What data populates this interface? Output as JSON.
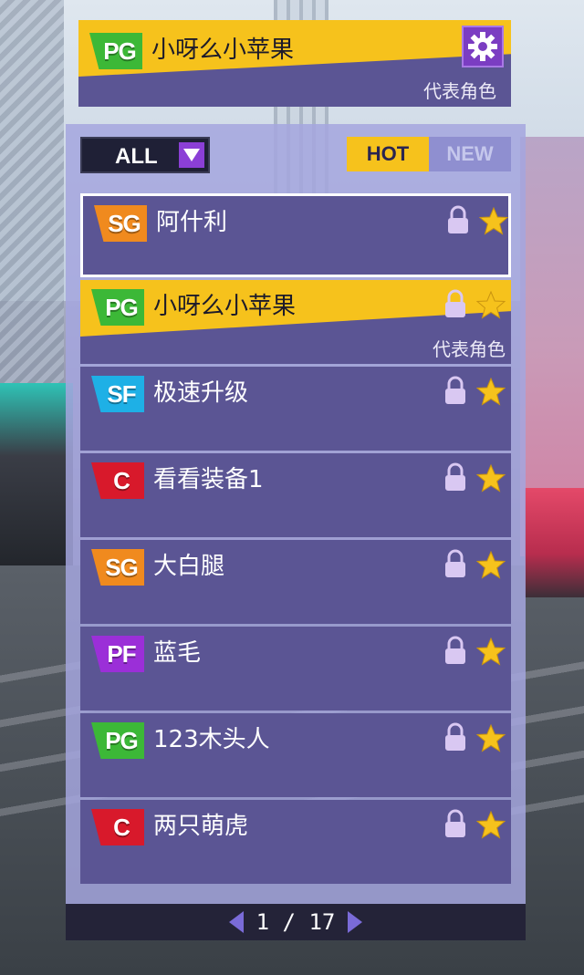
{
  "player": {
    "badge": "PG",
    "name": "小呀么小苹果",
    "tag": "代表角色"
  },
  "filter": {
    "value": "ALL"
  },
  "tabs": [
    {
      "label": "HOT",
      "active": true
    },
    {
      "label": "NEW",
      "active": false
    }
  ],
  "characters": [
    {
      "badge": "SG",
      "name": "阿什利",
      "tag": "",
      "selected": true,
      "featured": false
    },
    {
      "badge": "PG",
      "name": "小呀么小苹果",
      "tag": "代表角色",
      "selected": false,
      "featured": true
    },
    {
      "badge": "SF",
      "name": "极速升级",
      "tag": "",
      "selected": false,
      "featured": false
    },
    {
      "badge": "C",
      "name": "看看装备1",
      "tag": "",
      "selected": false,
      "featured": false
    },
    {
      "badge": "SG",
      "name": "大白腿",
      "tag": "",
      "selected": false,
      "featured": false
    },
    {
      "badge": "PF",
      "name": "蓝毛",
      "tag": "",
      "selected": false,
      "featured": false
    },
    {
      "badge": "PG",
      "name": "123木头人",
      "tag": "",
      "selected": false,
      "featured": false
    },
    {
      "badge": "C",
      "name": "两只萌虎",
      "tag": "",
      "selected": false,
      "featured": false
    }
  ],
  "pager": {
    "text": "1 / 17"
  },
  "colors": {
    "accent_yellow": "#f6c21c",
    "row_purple": "#5b5594",
    "lock_color": "#d9c8f2",
    "star_color": "#f6c21c"
  },
  "icons": {
    "settings": "gear-icon",
    "filter": "dropdown-arrow-icon",
    "lock": "lock-icon",
    "favorite": "star-icon",
    "prev": "prev-page-icon",
    "next": "next-page-icon"
  }
}
